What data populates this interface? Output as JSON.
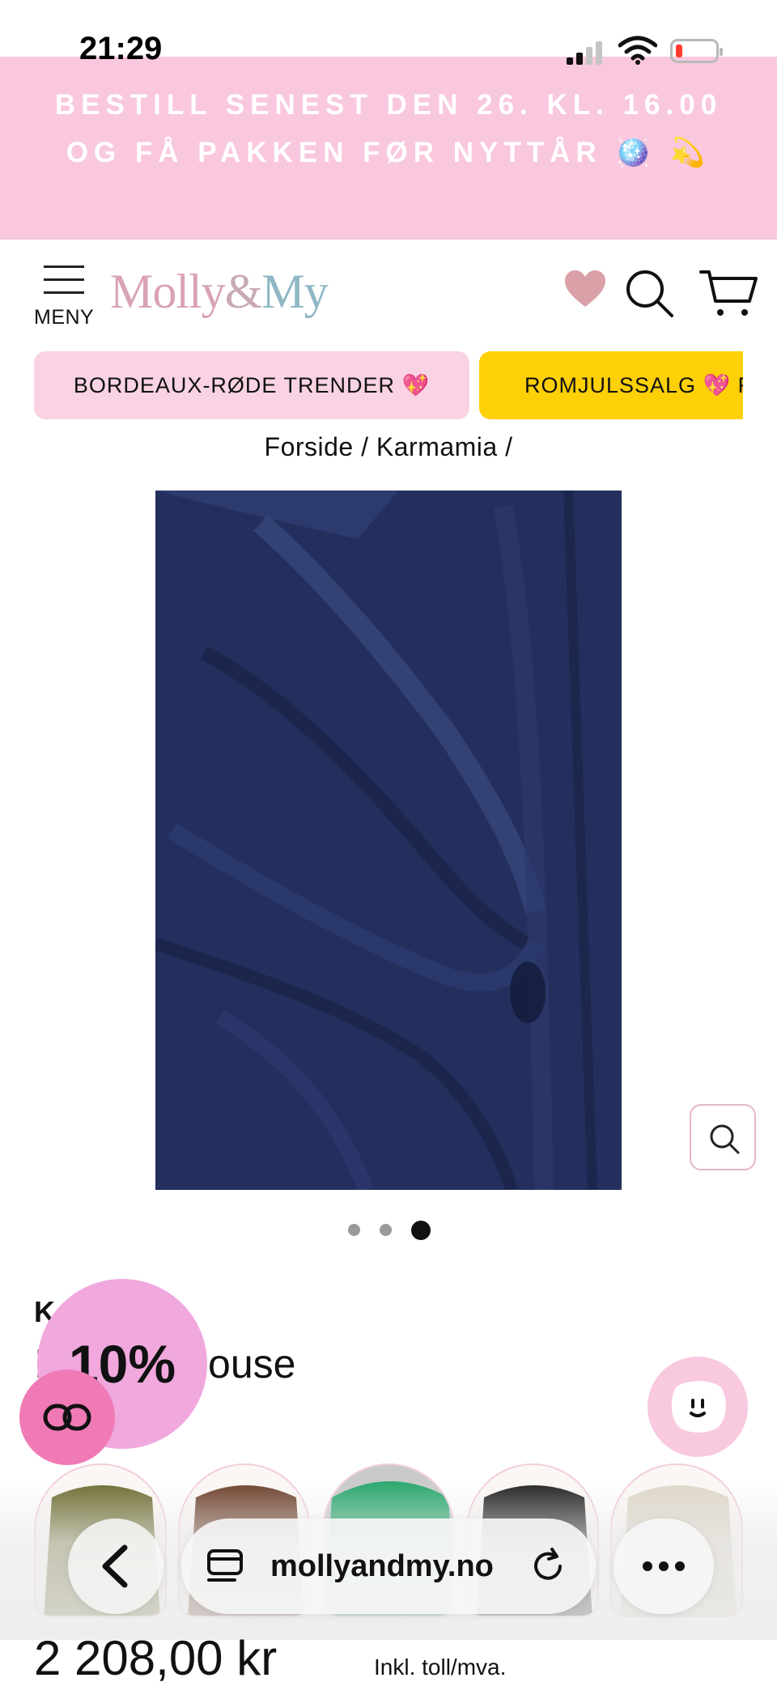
{
  "status_bar": {
    "time": "21:29"
  },
  "promo_banner": {
    "text": "BESTILL SENEST DEN 26. KL. 16.00 OG FÅ PAKKEN FØR NYTTÅR 🪩 💫"
  },
  "header": {
    "menu_label": "MENY",
    "logo_parts": {
      "left": "Molly",
      "amp": "&",
      "right": "My"
    }
  },
  "category_pills": [
    {
      "label": "BORDEAUX-RØDE TRENDER 💖",
      "color": "#f9d3e3"
    },
    {
      "label": "ROMJULSSALG 💖 F",
      "color": "#fdd007"
    }
  ],
  "breadcrumb": "Forside / Karmamia /",
  "gallery": {
    "image_subject": "navy satin wrap blouse detail",
    "image_color": "#232f5d",
    "dots_total": 3,
    "active_dot": 3
  },
  "product": {
    "brand_partial": "K",
    "title_partial_left": "I",
    "title_partial_right": "louse",
    "price": "2 208,00 kr",
    "price_note": "Inkl. toll/mva."
  },
  "discount_bubble": {
    "label": "10%",
    "color": "#f0a8dd"
  },
  "color_swatches": [
    {
      "name": "olive",
      "color": "#6c6a2e"
    },
    {
      "name": "brown",
      "color": "#6a3e28"
    },
    {
      "name": "green",
      "color": "#26a56a"
    },
    {
      "name": "black",
      "color": "#1d1d1d"
    },
    {
      "name": "cream",
      "color": "#ded6c8"
    }
  ],
  "browser_bar": {
    "url": "mollyandmy.no"
  },
  "icons": {
    "menu": "hamburger-icon",
    "wishlist": "heart-icon",
    "search": "search-icon",
    "cart": "cart-icon",
    "zoom": "zoom-icon",
    "loop": "loop-icon",
    "chat": "chat-face-icon",
    "back": "chevron-left-icon",
    "reader": "reader-icon",
    "reload": "reload-icon",
    "more": "more-icon"
  }
}
